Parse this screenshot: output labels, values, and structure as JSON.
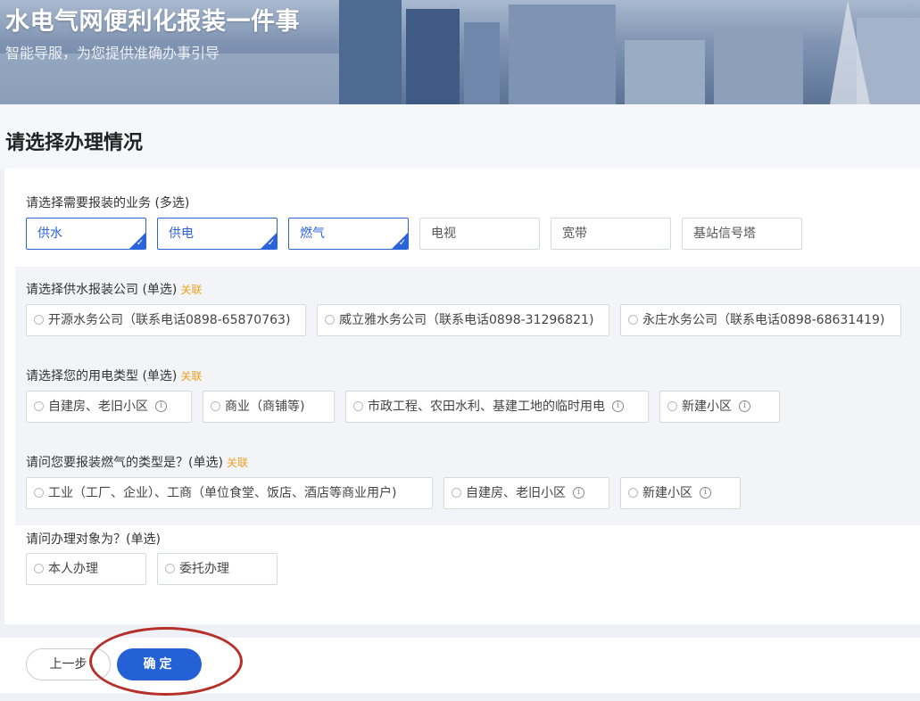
{
  "banner": {
    "title": "水电气网便利化报装一件事",
    "subtitle": "智能导服，为您提供准确办事引导"
  },
  "page_title": "请选择办理情况",
  "business": {
    "label": "请选择需要报装的业务 (多选)",
    "options": [
      {
        "label": "供水",
        "selected": true
      },
      {
        "label": "供电",
        "selected": true
      },
      {
        "label": "燃气",
        "selected": true
      },
      {
        "label": "电视",
        "selected": false
      },
      {
        "label": "宽带",
        "selected": false
      },
      {
        "label": "基站信号塔",
        "selected": false
      }
    ]
  },
  "water": {
    "label": "请选择供水报装公司 (单选)",
    "tag": "关联",
    "options": [
      "开源水务公司（联系电话0898-65870763)",
      "威立雅水务公司（联系电话0898-31296821)",
      "永庄水务公司（联系电话0898-68631419)"
    ]
  },
  "power": {
    "label": "请选择您的用电类型 (单选)",
    "tag": "关联",
    "options": [
      "自建房、老旧小区",
      "商业（商铺等)",
      "市政工程、农田水利、基建工地的临时用电",
      "新建小区"
    ]
  },
  "gas": {
    "label": "请问您要报装燃气的类型是？(单选)",
    "tag": "关联",
    "options": [
      "工业（工厂、企业）、工商（单位食堂、饭店、酒店等商业用户)",
      "自建房、老旧小区",
      "新建小区"
    ]
  },
  "applicant": {
    "label": "请问办理对象为？(单选)",
    "options": [
      "本人办理",
      "委托办理"
    ]
  },
  "footer": {
    "prev_label": "上一步",
    "confirm_label": "确定"
  },
  "colors": {
    "accent": "#2461d6",
    "tag": "#f0a020",
    "annotation": "#b5302b"
  }
}
